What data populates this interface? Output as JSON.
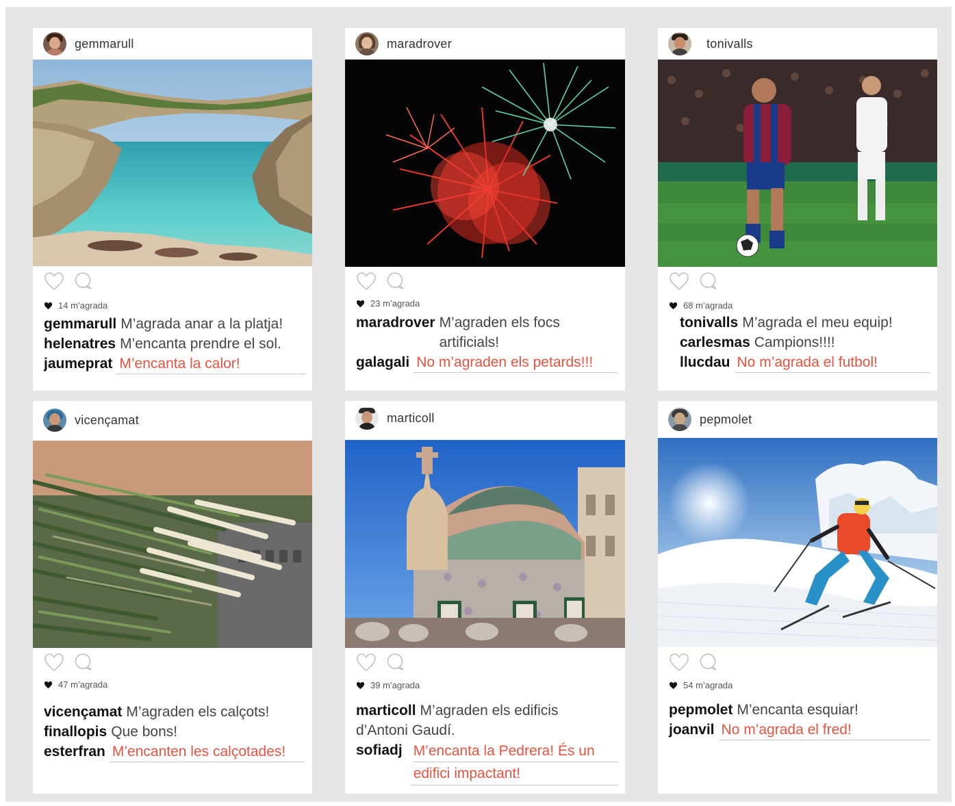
{
  "posts": [
    {
      "author": "gemmarull",
      "likes": "14 m’agrada",
      "comments": [
        {
          "user": "gemmarull",
          "text": "M’agrada anar a la platja!"
        },
        {
          "user": "helenatres",
          "text": "M’encanta prendre el sol."
        }
      ],
      "reply": {
        "user": "jaumeprat",
        "lines": [
          "M’encanta la calor!"
        ]
      }
    },
    {
      "author": "maradrover",
      "likes": "23 m’agrada",
      "comments": [
        {
          "user": "maradrover",
          "text": "M’agraden els focs artificials!"
        }
      ],
      "reply": {
        "user": "galagali",
        "lines": [
          "No m’agraden els petards!!!"
        ]
      }
    },
    {
      "author": "tonivalls",
      "likes": "68 m’agrada",
      "comments": [
        {
          "user": "tonivalls",
          "text": "M’agrada el meu equip!"
        },
        {
          "user": "carlesmas",
          "text": "Campions!!!!"
        }
      ],
      "reply": {
        "user": "llucdau",
        "lines": [
          "No m’agrada el futbol!"
        ]
      }
    },
    {
      "author": "vicençamat",
      "likes": "47 m’agrada",
      "comments": [
        {
          "user": "vicençamat",
          "text": "M’agraden els calçots!"
        },
        {
          "user": "finallopis",
          "text": "Que bons!"
        }
      ],
      "reply": {
        "user": "esterfran",
        "lines": [
          "M’encanten les calçotades!"
        ]
      }
    },
    {
      "author": "marticoll",
      "likes": "39 m’agrada",
      "comments": [
        {
          "user": "marticoll",
          "text": "M’agraden els edificis"
        },
        {
          "user": "",
          "text": "d’Antoni Gaudí."
        }
      ],
      "reply": {
        "user": "sofiadj",
        "lines": [
          "M’encanta la Pedrera! És un",
          "edifici impactant!"
        ]
      }
    },
    {
      "author": "pepmolet",
      "likes": "54 m’agrada",
      "comments": [
        {
          "user": "pepmolet",
          "text": "M’encanta esquiar!"
        }
      ],
      "reply": {
        "user": "joanvil",
        "lines": [
          "No m’agrada el fred!"
        ]
      }
    }
  ],
  "icons": {
    "like": "heart-outline-icon",
    "comment": "speech-bubble-icon",
    "likes_marker": "heart-filled-icon"
  },
  "colors": {
    "reply_text": "#e8533f",
    "frame": "#e6e6e6"
  }
}
